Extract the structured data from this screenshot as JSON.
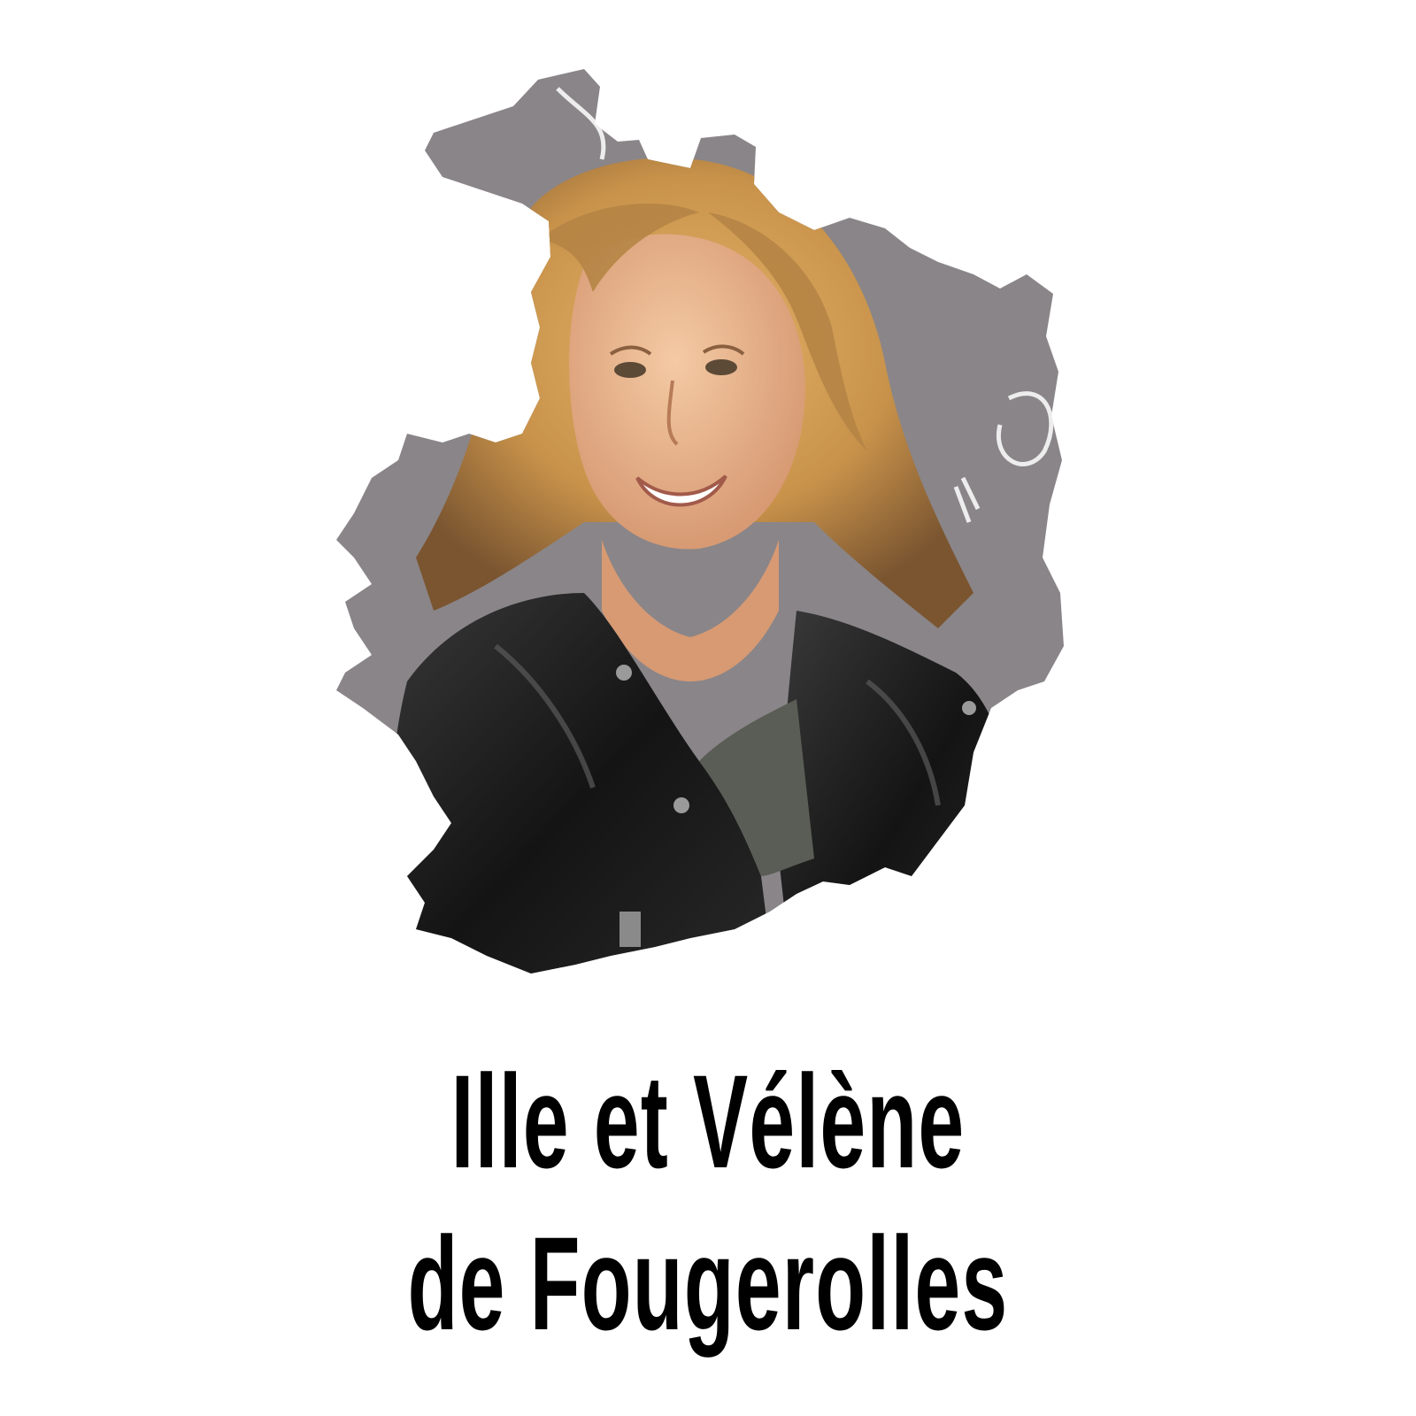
{
  "caption": {
    "line_1": "Ille et Vélène",
    "line_2": "de Fougerolles"
  },
  "colors": {
    "background": "#ffffff",
    "map_fill": "#8a8588",
    "text": "#000000"
  },
  "illustration": {
    "shape": "department-map-silhouette",
    "content": "portrait-photo"
  }
}
